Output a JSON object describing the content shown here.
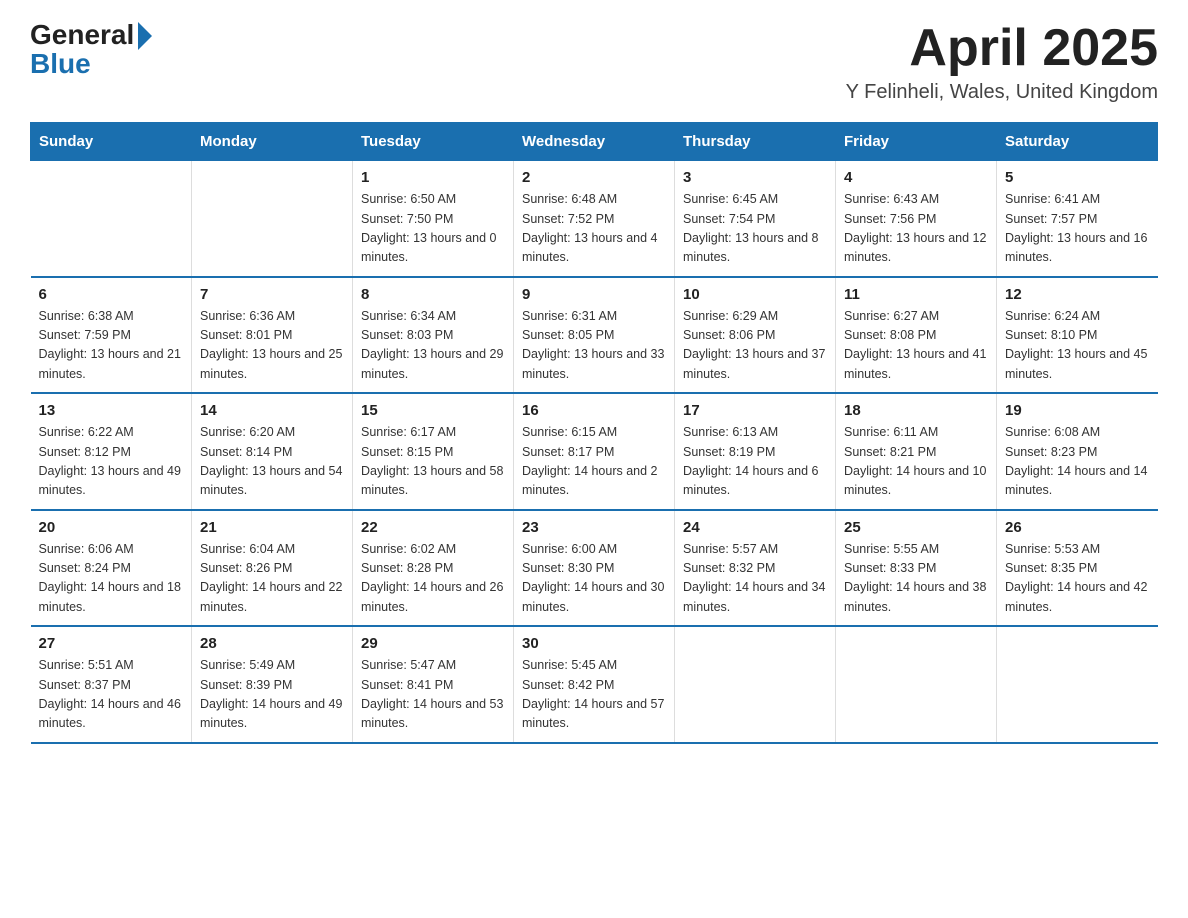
{
  "header": {
    "logo_general": "General",
    "logo_arrow": "▶",
    "logo_blue": "Blue",
    "month": "April 2025",
    "location": "Y Felinheli, Wales, United Kingdom"
  },
  "weekdays": [
    "Sunday",
    "Monday",
    "Tuesday",
    "Wednesday",
    "Thursday",
    "Friday",
    "Saturday"
  ],
  "weeks": [
    [
      {
        "day": "",
        "sunrise": "",
        "sunset": "",
        "daylight": ""
      },
      {
        "day": "",
        "sunrise": "",
        "sunset": "",
        "daylight": ""
      },
      {
        "day": "1",
        "sunrise": "Sunrise: 6:50 AM",
        "sunset": "Sunset: 7:50 PM",
        "daylight": "Daylight: 13 hours and 0 minutes."
      },
      {
        "day": "2",
        "sunrise": "Sunrise: 6:48 AM",
        "sunset": "Sunset: 7:52 PM",
        "daylight": "Daylight: 13 hours and 4 minutes."
      },
      {
        "day": "3",
        "sunrise": "Sunrise: 6:45 AM",
        "sunset": "Sunset: 7:54 PM",
        "daylight": "Daylight: 13 hours and 8 minutes."
      },
      {
        "day": "4",
        "sunrise": "Sunrise: 6:43 AM",
        "sunset": "Sunset: 7:56 PM",
        "daylight": "Daylight: 13 hours and 12 minutes."
      },
      {
        "day": "5",
        "sunrise": "Sunrise: 6:41 AM",
        "sunset": "Sunset: 7:57 PM",
        "daylight": "Daylight: 13 hours and 16 minutes."
      }
    ],
    [
      {
        "day": "6",
        "sunrise": "Sunrise: 6:38 AM",
        "sunset": "Sunset: 7:59 PM",
        "daylight": "Daylight: 13 hours and 21 minutes."
      },
      {
        "day": "7",
        "sunrise": "Sunrise: 6:36 AM",
        "sunset": "Sunset: 8:01 PM",
        "daylight": "Daylight: 13 hours and 25 minutes."
      },
      {
        "day": "8",
        "sunrise": "Sunrise: 6:34 AM",
        "sunset": "Sunset: 8:03 PM",
        "daylight": "Daylight: 13 hours and 29 minutes."
      },
      {
        "day": "9",
        "sunrise": "Sunrise: 6:31 AM",
        "sunset": "Sunset: 8:05 PM",
        "daylight": "Daylight: 13 hours and 33 minutes."
      },
      {
        "day": "10",
        "sunrise": "Sunrise: 6:29 AM",
        "sunset": "Sunset: 8:06 PM",
        "daylight": "Daylight: 13 hours and 37 minutes."
      },
      {
        "day": "11",
        "sunrise": "Sunrise: 6:27 AM",
        "sunset": "Sunset: 8:08 PM",
        "daylight": "Daylight: 13 hours and 41 minutes."
      },
      {
        "day": "12",
        "sunrise": "Sunrise: 6:24 AM",
        "sunset": "Sunset: 8:10 PM",
        "daylight": "Daylight: 13 hours and 45 minutes."
      }
    ],
    [
      {
        "day": "13",
        "sunrise": "Sunrise: 6:22 AM",
        "sunset": "Sunset: 8:12 PM",
        "daylight": "Daylight: 13 hours and 49 minutes."
      },
      {
        "day": "14",
        "sunrise": "Sunrise: 6:20 AM",
        "sunset": "Sunset: 8:14 PM",
        "daylight": "Daylight: 13 hours and 54 minutes."
      },
      {
        "day": "15",
        "sunrise": "Sunrise: 6:17 AM",
        "sunset": "Sunset: 8:15 PM",
        "daylight": "Daylight: 13 hours and 58 minutes."
      },
      {
        "day": "16",
        "sunrise": "Sunrise: 6:15 AM",
        "sunset": "Sunset: 8:17 PM",
        "daylight": "Daylight: 14 hours and 2 minutes."
      },
      {
        "day": "17",
        "sunrise": "Sunrise: 6:13 AM",
        "sunset": "Sunset: 8:19 PM",
        "daylight": "Daylight: 14 hours and 6 minutes."
      },
      {
        "day": "18",
        "sunrise": "Sunrise: 6:11 AM",
        "sunset": "Sunset: 8:21 PM",
        "daylight": "Daylight: 14 hours and 10 minutes."
      },
      {
        "day": "19",
        "sunrise": "Sunrise: 6:08 AM",
        "sunset": "Sunset: 8:23 PM",
        "daylight": "Daylight: 14 hours and 14 minutes."
      }
    ],
    [
      {
        "day": "20",
        "sunrise": "Sunrise: 6:06 AM",
        "sunset": "Sunset: 8:24 PM",
        "daylight": "Daylight: 14 hours and 18 minutes."
      },
      {
        "day": "21",
        "sunrise": "Sunrise: 6:04 AM",
        "sunset": "Sunset: 8:26 PM",
        "daylight": "Daylight: 14 hours and 22 minutes."
      },
      {
        "day": "22",
        "sunrise": "Sunrise: 6:02 AM",
        "sunset": "Sunset: 8:28 PM",
        "daylight": "Daylight: 14 hours and 26 minutes."
      },
      {
        "day": "23",
        "sunrise": "Sunrise: 6:00 AM",
        "sunset": "Sunset: 8:30 PM",
        "daylight": "Daylight: 14 hours and 30 minutes."
      },
      {
        "day": "24",
        "sunrise": "Sunrise: 5:57 AM",
        "sunset": "Sunset: 8:32 PM",
        "daylight": "Daylight: 14 hours and 34 minutes."
      },
      {
        "day": "25",
        "sunrise": "Sunrise: 5:55 AM",
        "sunset": "Sunset: 8:33 PM",
        "daylight": "Daylight: 14 hours and 38 minutes."
      },
      {
        "day": "26",
        "sunrise": "Sunrise: 5:53 AM",
        "sunset": "Sunset: 8:35 PM",
        "daylight": "Daylight: 14 hours and 42 minutes."
      }
    ],
    [
      {
        "day": "27",
        "sunrise": "Sunrise: 5:51 AM",
        "sunset": "Sunset: 8:37 PM",
        "daylight": "Daylight: 14 hours and 46 minutes."
      },
      {
        "day": "28",
        "sunrise": "Sunrise: 5:49 AM",
        "sunset": "Sunset: 8:39 PM",
        "daylight": "Daylight: 14 hours and 49 minutes."
      },
      {
        "day": "29",
        "sunrise": "Sunrise: 5:47 AM",
        "sunset": "Sunset: 8:41 PM",
        "daylight": "Daylight: 14 hours and 53 minutes."
      },
      {
        "day": "30",
        "sunrise": "Sunrise: 5:45 AM",
        "sunset": "Sunset: 8:42 PM",
        "daylight": "Daylight: 14 hours and 57 minutes."
      },
      {
        "day": "",
        "sunrise": "",
        "sunset": "",
        "daylight": ""
      },
      {
        "day": "",
        "sunrise": "",
        "sunset": "",
        "daylight": ""
      },
      {
        "day": "",
        "sunrise": "",
        "sunset": "",
        "daylight": ""
      }
    ]
  ]
}
